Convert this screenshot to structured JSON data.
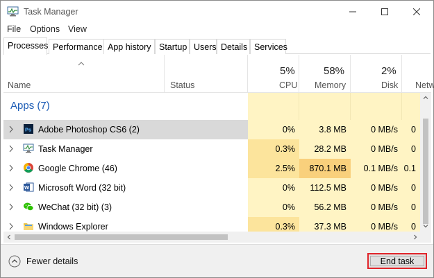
{
  "window": {
    "title": "Task Manager",
    "icon": "task-manager-icon",
    "controls": [
      "minimize-icon",
      "maximize-icon",
      "close-icon"
    ]
  },
  "menu": [
    "File",
    "Options",
    "View"
  ],
  "tabs": [
    "Processes",
    "Performance",
    "App history",
    "Startup",
    "Users",
    "Details",
    "Services"
  ],
  "active_tab": "Processes",
  "columns": {
    "name": "Name",
    "status": "Status",
    "cpu": {
      "label": "CPU",
      "percent": "5%"
    },
    "memory": {
      "label": "Memory",
      "percent": "58%"
    },
    "disk": {
      "label": "Disk",
      "percent": "2%"
    },
    "network": {
      "label": "Netw"
    }
  },
  "group": {
    "label": "Apps (7)"
  },
  "rows": [
    {
      "name": "Adobe Photoshop CS6 (2)",
      "icon": "photoshop-icon",
      "cpu": "0%",
      "memory": "3.8 MB",
      "disk": "0 MB/s",
      "network": "0"
    },
    {
      "name": "Task Manager",
      "icon": "task-manager-icon",
      "cpu": "0.3%",
      "memory": "28.2 MB",
      "disk": "0 MB/s",
      "network": "0"
    },
    {
      "name": "Google Chrome (46)",
      "icon": "chrome-icon",
      "cpu": "2.5%",
      "memory": "870.1 MB",
      "disk": "0.1 MB/s",
      "network": "0.1"
    },
    {
      "name": "Microsoft Word (32 bit)",
      "icon": "word-icon",
      "cpu": "0%",
      "memory": "112.5 MB",
      "disk": "0 MB/s",
      "network": "0"
    },
    {
      "name": "WeChat (32 bit) (3)",
      "icon": "wechat-icon",
      "cpu": "0%",
      "memory": "56.2 MB",
      "disk": "0 MB/s",
      "network": "0"
    },
    {
      "name": "Windows Explorer",
      "icon": "folder-icon",
      "cpu": "0.3%",
      "memory": "37.3 MB",
      "disk": "0 MB/s",
      "network": "0"
    }
  ],
  "selected_row": 0,
  "footer": {
    "fewer_details": "Fewer details",
    "end_task": "End task"
  },
  "colors": {
    "heat_light": "#fff4c4",
    "heat_medium": "#fce49c",
    "heat_high": "#f9d07c",
    "selection": "#d9d9d9",
    "group_blue": "#1b5bb5",
    "highlight_red": "#e1252b"
  }
}
